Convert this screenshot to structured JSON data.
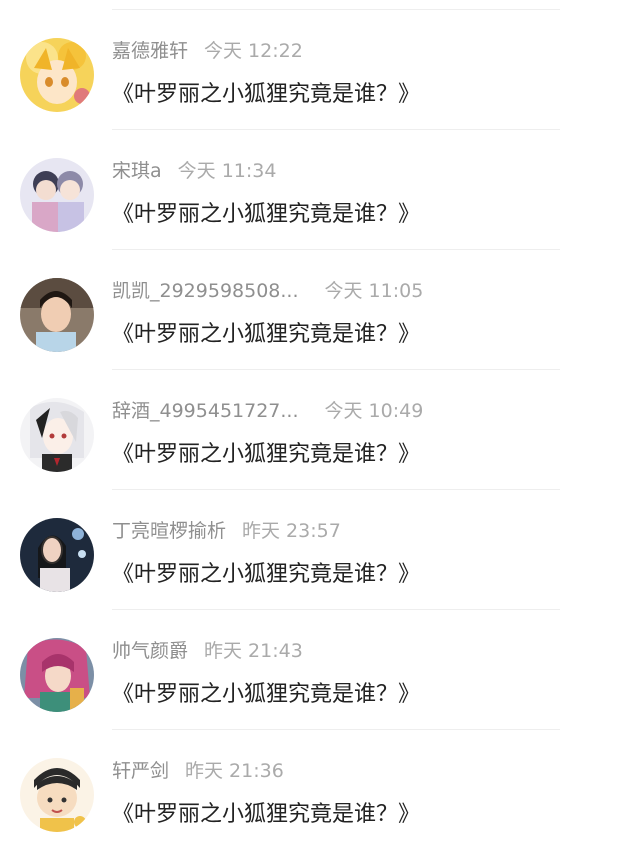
{
  "conversations": [
    {
      "name": "嘉德雅轩",
      "time": "今天 12:22",
      "message": "《叶罗丽之小狐狸究竟是谁？》",
      "avatar_color": "#f2c94c"
    },
    {
      "name": "宋琪a",
      "time": "今天 11:34",
      "message": "《叶罗丽之小狐狸究竟是谁？》",
      "avatar_color": "#c9c6e6"
    },
    {
      "name": "凯凯_2929598508...",
      "time": "今天 11:05",
      "message": "《叶罗丽之小狐狸究竟是谁？》",
      "avatar_color": "#6e5b4d"
    },
    {
      "name": "辞酒_4995451727...",
      "time": "今天 10:49",
      "message": "《叶罗丽之小狐狸究竟是谁？》",
      "avatar_color": "#d9d9de"
    },
    {
      "name": "丁亮暄椤揄析",
      "time": "昨天 23:57",
      "message": "《叶罗丽之小狐狸究竟是谁？》",
      "avatar_color": "#2b3a4f"
    },
    {
      "name": "帅气颜爵",
      "time": "昨天 21:43",
      "message": "《叶罗丽之小狐狸究竟是谁？》",
      "avatar_color": "#c2628a"
    },
    {
      "name": "轩严剑",
      "time": "昨天 21:36",
      "message": "《叶罗丽之小狐狸究竟是谁？》",
      "avatar_color": "#f1d7b6"
    }
  ]
}
